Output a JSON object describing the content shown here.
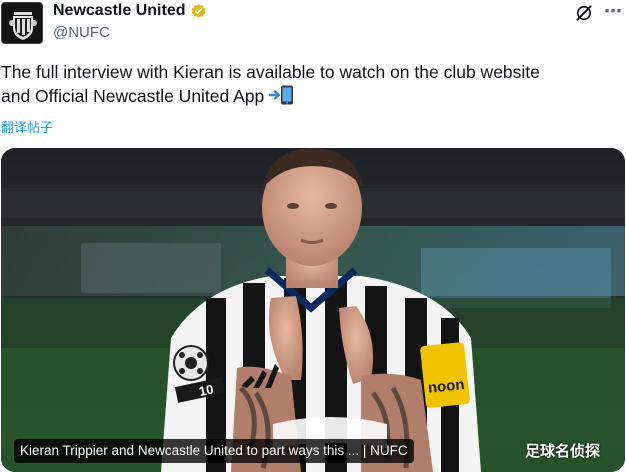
{
  "post": {
    "display_name": "Newcastle United",
    "handle": "@NUFC",
    "text_line1": "The full interview with Kieran is available to watch on the club website",
    "text_line2": "and Official Newcastle United App",
    "emoji_icon": "mobile-phone-arrow-icon",
    "translate_label": "翻译帖子"
  },
  "media": {
    "caption": "Kieran Trippier and Newcastle United to part ways this ... | NUFC",
    "watermark": "足球名侦探",
    "captain_band_text": "noon",
    "shirt_number": "10"
  },
  "colors": {
    "link": "#1d9bf0",
    "verified_badge": "#e2b719",
    "captain_band": "#f2c300",
    "text_secondary": "#536471"
  }
}
